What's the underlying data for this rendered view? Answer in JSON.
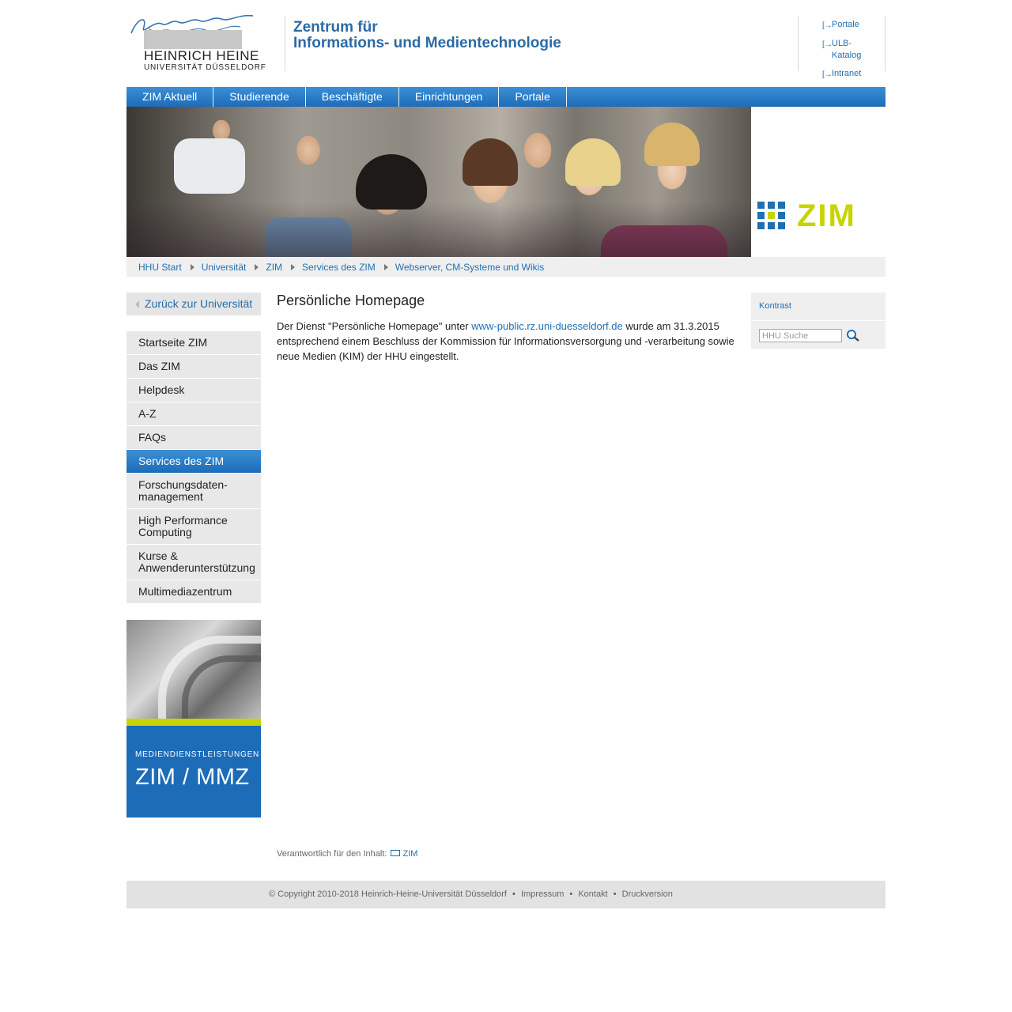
{
  "header": {
    "logo": {
      "signature": "Heinrich Heine",
      "name": "HEINRICH HEINE",
      "sub": "UNIVERSITÄT DÜSSELDORF"
    },
    "title_line1": "Zentrum für",
    "title_line2": "Informations- und Medientechnologie",
    "quicklinks": [
      {
        "label": "Portale"
      },
      {
        "label": "ULB-Katalog"
      },
      {
        "label": "Intranet"
      }
    ]
  },
  "topnav": {
    "tabs": [
      {
        "label": "ZIM Aktuell"
      },
      {
        "label": "Studierende"
      },
      {
        "label": "Beschäftigte"
      },
      {
        "label": "Einrichtungen"
      },
      {
        "label": "Portale"
      }
    ]
  },
  "banner": {
    "logo_text": "ZIM",
    "accent_color": "#c8d400",
    "brand_color": "#1f6fb2"
  },
  "breadcrumb": [
    {
      "label": "HHU Start"
    },
    {
      "label": "Universität"
    },
    {
      "label": "ZIM"
    },
    {
      "label": "Services des ZIM"
    },
    {
      "label": "Webserver, CM-Systeme und Wikis"
    }
  ],
  "sidebar": {
    "back_link": "Zurück zur Universität",
    "items": [
      {
        "label": "Startseite ZIM"
      },
      {
        "label": "Das ZIM"
      },
      {
        "label": "Helpdesk"
      },
      {
        "label": "A-Z"
      },
      {
        "label": "FAQs"
      },
      {
        "label": "Services des ZIM"
      },
      {
        "label": "Forschungsdaten-management"
      },
      {
        "label": "High Performance Computing"
      },
      {
        "label": "Kurse & Anwenderunterstützung"
      },
      {
        "label": "Multimediazentrum"
      }
    ],
    "active_item": "Services des ZIM",
    "promo": {
      "caption": "MEDIENDIENSTLEISTUNGEN",
      "title": "ZIM / MMZ"
    }
  },
  "main": {
    "heading": "Persönliche Homepage",
    "text_before_link": "Der Dienst \"Persönliche Homepage\" unter ",
    "link": "www-public.rz.uni-duesseldorf.de",
    "text_after_link": " wurde am 31.3.2015 entsprechend einem Beschluss der Kommission für Informationsversorgung und -verarbeitung sowie neue Medien (KIM) der HHU eingestellt.",
    "responsible_label": "Verantwortlich für den Inhalt:",
    "responsible_link": "ZIM"
  },
  "rightbox": {
    "kontrast": "Kontrast",
    "search_placeholder": "HHU Suche"
  },
  "footer": {
    "copyright": "© Copyright 2010-2018 Heinrich-Heine-Universität Düsseldorf",
    "links": [
      {
        "label": "Impressum"
      },
      {
        "label": "Kontakt"
      },
      {
        "label": "Druckversion"
      }
    ]
  }
}
